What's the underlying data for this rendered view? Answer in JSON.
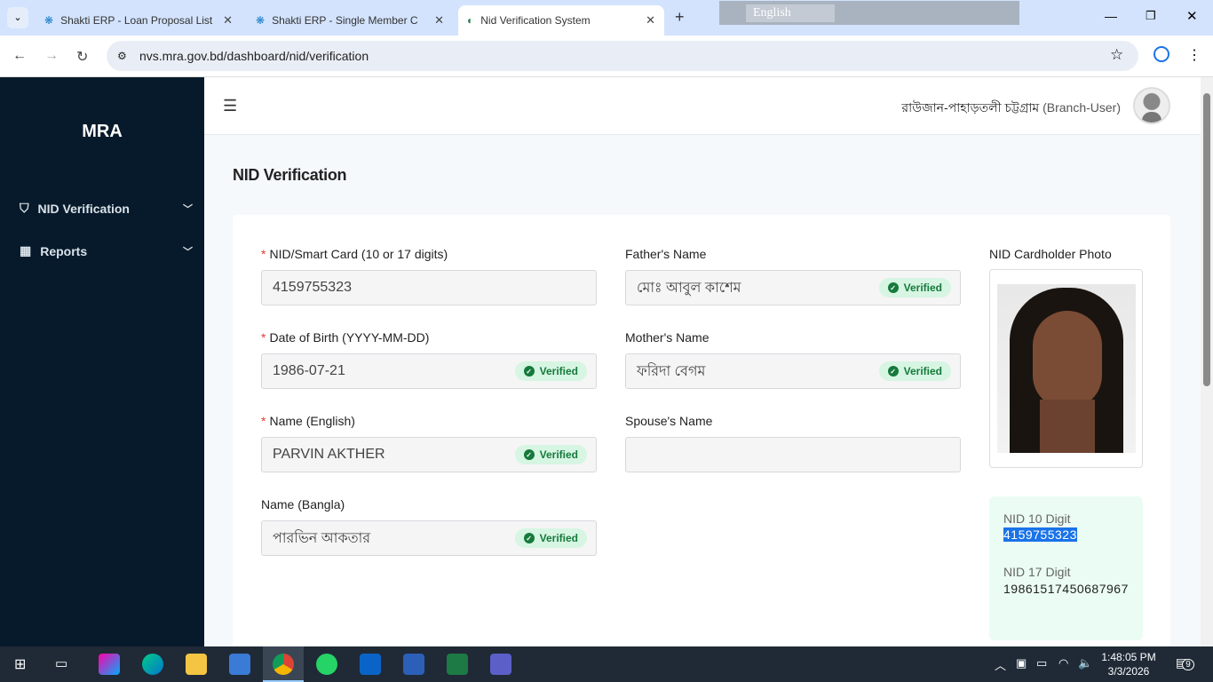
{
  "browser": {
    "tabs": [
      {
        "label": "Shakti ERP - Loan Proposal List"
      },
      {
        "label": "Shakti ERP - Single Member Co"
      },
      {
        "label": "Nid Verification System"
      }
    ],
    "url": "nvs.mra.gov.bd/dashboard/nid/verification",
    "ime_language": "English"
  },
  "sidebar": {
    "brand": "MRA",
    "items": [
      {
        "label": "NID Verification"
      },
      {
        "label": "Reports"
      }
    ]
  },
  "header": {
    "user": "রাউজান-পাহাড়তলী চট্টগ্রাম",
    "role": "(Branch-User)"
  },
  "page": {
    "title": "NID Verification"
  },
  "form": {
    "verified_label": "Verified",
    "nid": {
      "label": "NID/Smart Card (10 or 17 digits)",
      "value": "4159755323"
    },
    "dob": {
      "label": "Date of Birth (YYYY-MM-DD)",
      "value": "1986-07-21"
    },
    "name_en": {
      "label": "Name (English)",
      "value": "PARVIN AKTHER"
    },
    "name_bn": {
      "label": "Name (Bangla)",
      "value": "পারভিন আকতার"
    },
    "father": {
      "label": "Father's Name",
      "value": "মোঃ আবুল কাশেম"
    },
    "mother": {
      "label": "Mother's Name",
      "value": "ফরিদা বেগম"
    },
    "spouse": {
      "label": "Spouse's Name",
      "value": ""
    }
  },
  "photo": {
    "label": "NID Cardholder Photo"
  },
  "nid_info": {
    "ten_label": "NID 10 Digit",
    "ten_value": "4159755323",
    "seventeen_label": "NID 17 Digit",
    "seventeen_value": "19861517450687967"
  },
  "taskbar": {
    "time": "1:48:05 PM",
    "date": "3/3/2026",
    "notifications": "9"
  }
}
